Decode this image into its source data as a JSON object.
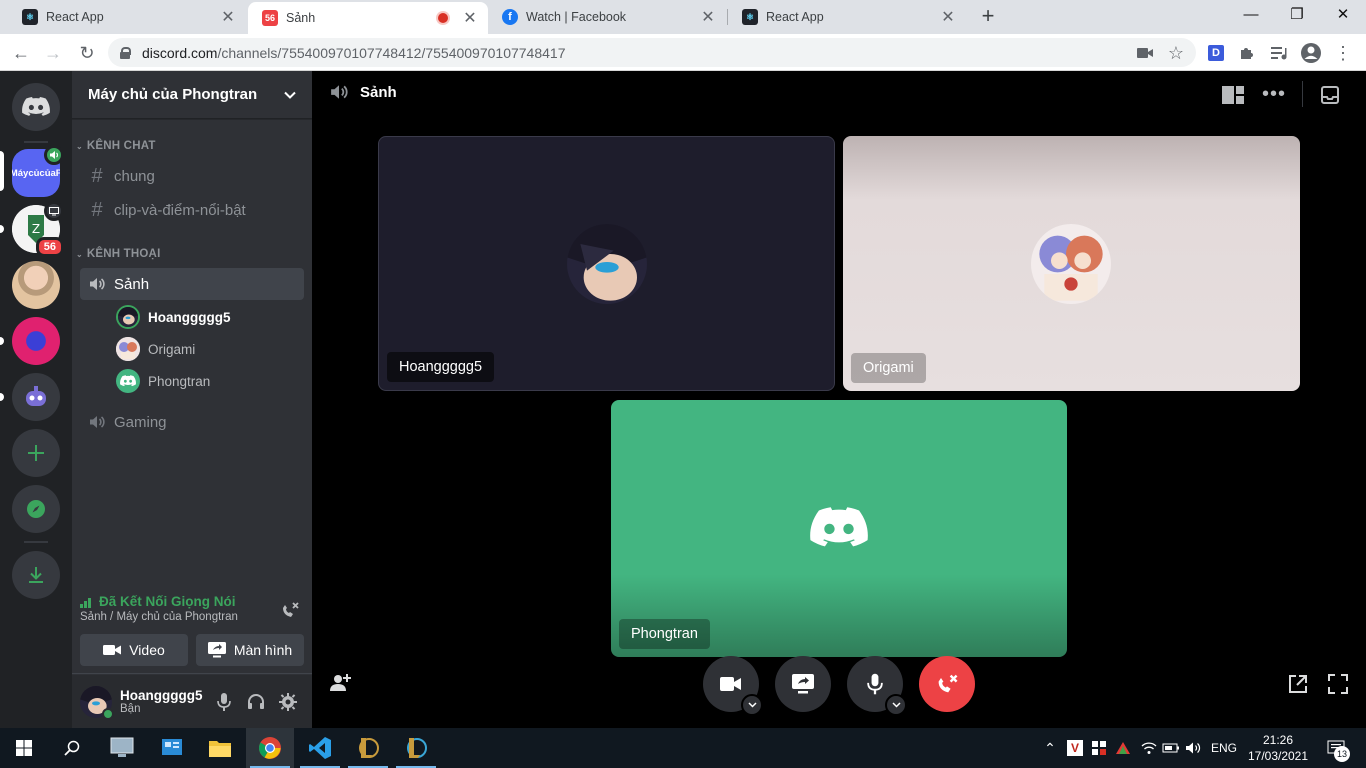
{
  "browser": {
    "tabs": [
      {
        "title": "React App",
        "favicon": "react-icon"
      },
      {
        "title": "Sảnh",
        "favicon": "discord-icon",
        "badge": "56",
        "recording": true
      },
      {
        "title": "Watch | Facebook",
        "favicon": "facebook-icon"
      },
      {
        "title": "React App",
        "favicon": "react-icon"
      }
    ],
    "url_host": "discord.com",
    "url_path": "/channels/755400970107748412/755400970107748417",
    "profile_initial": "D"
  },
  "guilds": {
    "server_abbrev": "MáycủcủaP",
    "zone_badge": "56"
  },
  "server": {
    "name": "Máy chủ của Phongtran",
    "categories": [
      "KÊNH CHAT",
      "KÊNH THOẠI"
    ],
    "text_channels": [
      "chung",
      "clip-và-điểm-nổi-bật"
    ],
    "voice_channels": [
      "Sảnh",
      "Gaming"
    ],
    "voice_users": [
      "Hoanggggg5",
      "Origami",
      "Phongtran"
    ]
  },
  "voice_panel": {
    "status": "Đã Kết Nối Giọng Nói",
    "location": "Sảnh / Máy chủ của Phongtran",
    "video_label": "Video",
    "screen_label": "Màn hình"
  },
  "user": {
    "name": "Hoanggggg5",
    "status": "Bận"
  },
  "stage": {
    "channel": "Sảnh",
    "tiles": [
      "Hoanggggg5",
      "Origami",
      "Phongtran"
    ]
  },
  "taskbar": {
    "lang": "ENG",
    "time": "21:26",
    "date": "17/03/2021",
    "notifications": "13"
  },
  "colors": {
    "discord_blurple": "#5865f2",
    "connected_green": "#3ba55d",
    "tile_green": "#43b581",
    "hangup_red": "#ed4245"
  }
}
